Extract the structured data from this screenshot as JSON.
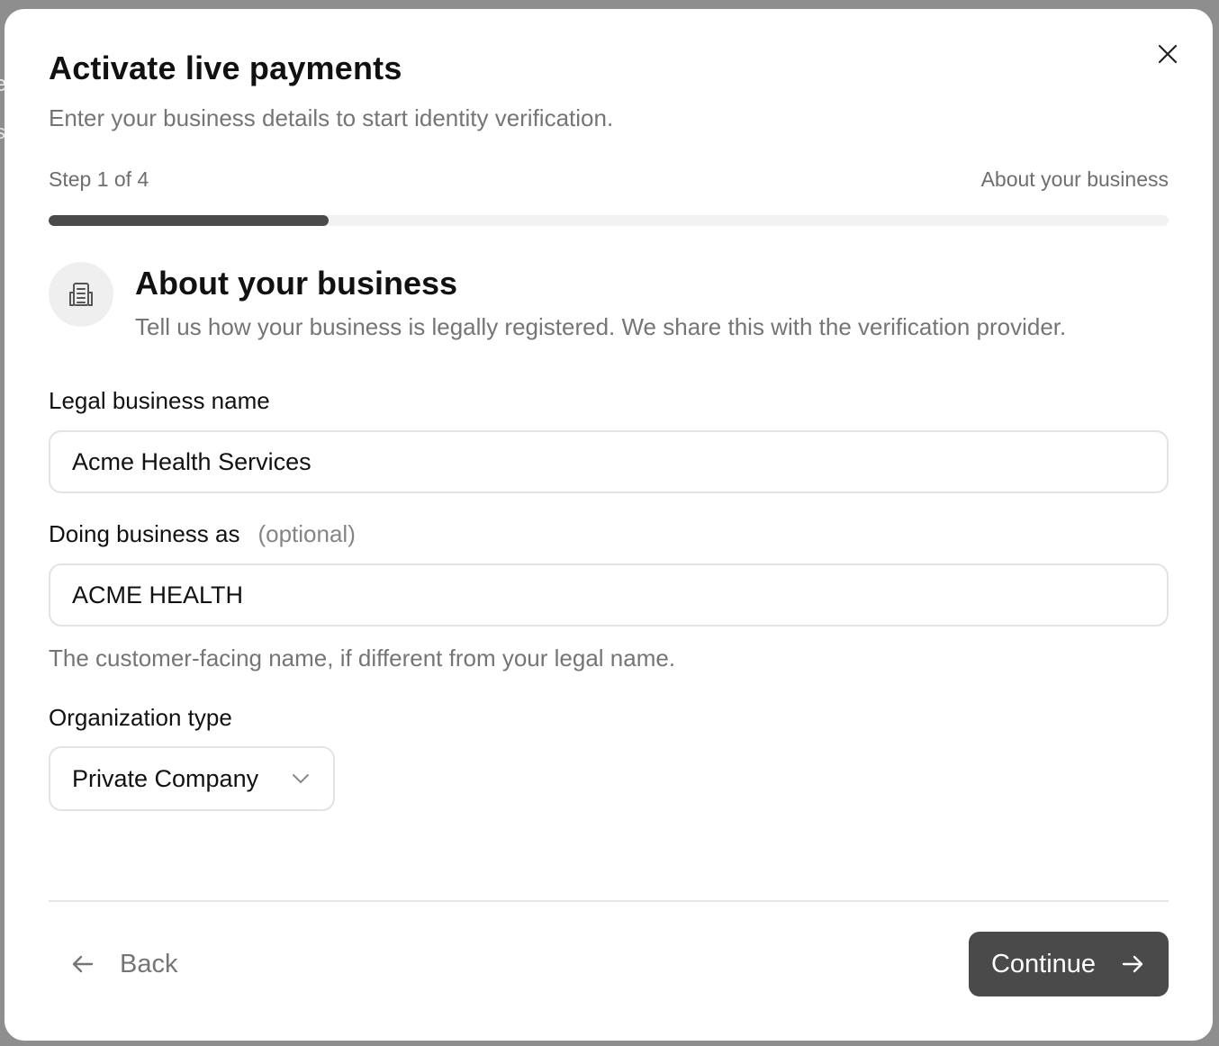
{
  "modal": {
    "title": "Activate live payments",
    "subtitle": "Enter your business details to start identity verification.",
    "close_icon": "close-icon"
  },
  "progress": {
    "step_text": "Step 1 of 4",
    "step_name": "About your business",
    "current_step": 1,
    "total_steps": 4,
    "fraction": 0.25,
    "fill_color": "#4a4a4a"
  },
  "section": {
    "icon": "building-document-icon",
    "title": "About your business",
    "description": "Tell us how your business is legally registered. We share this with the verification provider."
  },
  "form": {
    "legal_name": {
      "label": "Legal business name",
      "value": "Acme Health Services"
    },
    "dba": {
      "label": "Doing business as",
      "optional_label": "(optional)",
      "value": "ACME HEALTH",
      "hint": "The customer-facing name, if different from your legal name."
    },
    "org_type": {
      "label": "Organization type",
      "selected": "Private Company",
      "icon": "chevron-down-icon"
    }
  },
  "footer": {
    "back_label": "Back",
    "back_icon": "arrow-left-icon",
    "continue_label": "Continue",
    "continue_icon": "arrow-right-icon",
    "continue_bg": "#4a4a4a"
  }
}
